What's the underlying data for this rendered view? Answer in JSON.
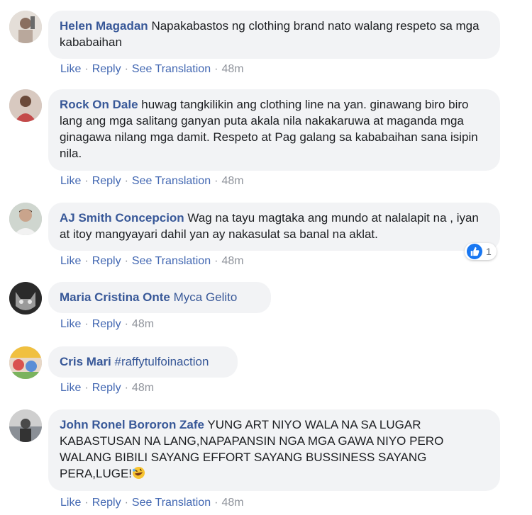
{
  "action_labels": {
    "like": "Like",
    "reply": "Reply",
    "see_translation": "See Translation",
    "separator": "·"
  },
  "comments": [
    {
      "author": "Helen Magadan",
      "text": "Napakabastos ng clothing brand nato walang respeto sa mga kababaihan",
      "time": "48m"
    },
    {
      "author": "Rock On Dale",
      "text": "huwag tangkilikin ang clothing line na yan. ginawang biro biro lang ang mga salitang ganyan puta akala nila nakakaruwa at maganda mga ginagawa nilang mga damit. Respeto at Pag galang sa kababaihan sana isipin nila.",
      "time": "48m"
    },
    {
      "author": "AJ Smith Concepcion",
      "text": "Wag na tayu magtaka ang mundo at nalalapit na , iyan at itoy mangyayari dahil yan ay nakasulat sa banal na aklat.",
      "time": "48m",
      "reaction_count": "1"
    },
    {
      "author": "Maria Cristina Onte",
      "mention": "Myca Gelito",
      "time": "48m"
    },
    {
      "author": "Cris Mari",
      "mention": "#raffytulfoinaction",
      "time": "48m"
    },
    {
      "author": "John Ronel Bororon Zafe",
      "text": "YUNG ART NIYO WALA NA SA LUGAR KABASTUSAN NA LANG,NAPAPANSIN NGA MGA GAWA NIYO PERO WALANG BIBILI SAYANG EFFORT SAYANG BUSSINESS SAYANG PERA,LUGE!",
      "time": "48m",
      "emoji": "rolling-on-floor-laughing-emoji"
    }
  ],
  "colors": {
    "author": "#385898",
    "bubble_bg": "#f2f3f5",
    "action_link": "#4267b2",
    "like_reaction": "#1877f2"
  }
}
